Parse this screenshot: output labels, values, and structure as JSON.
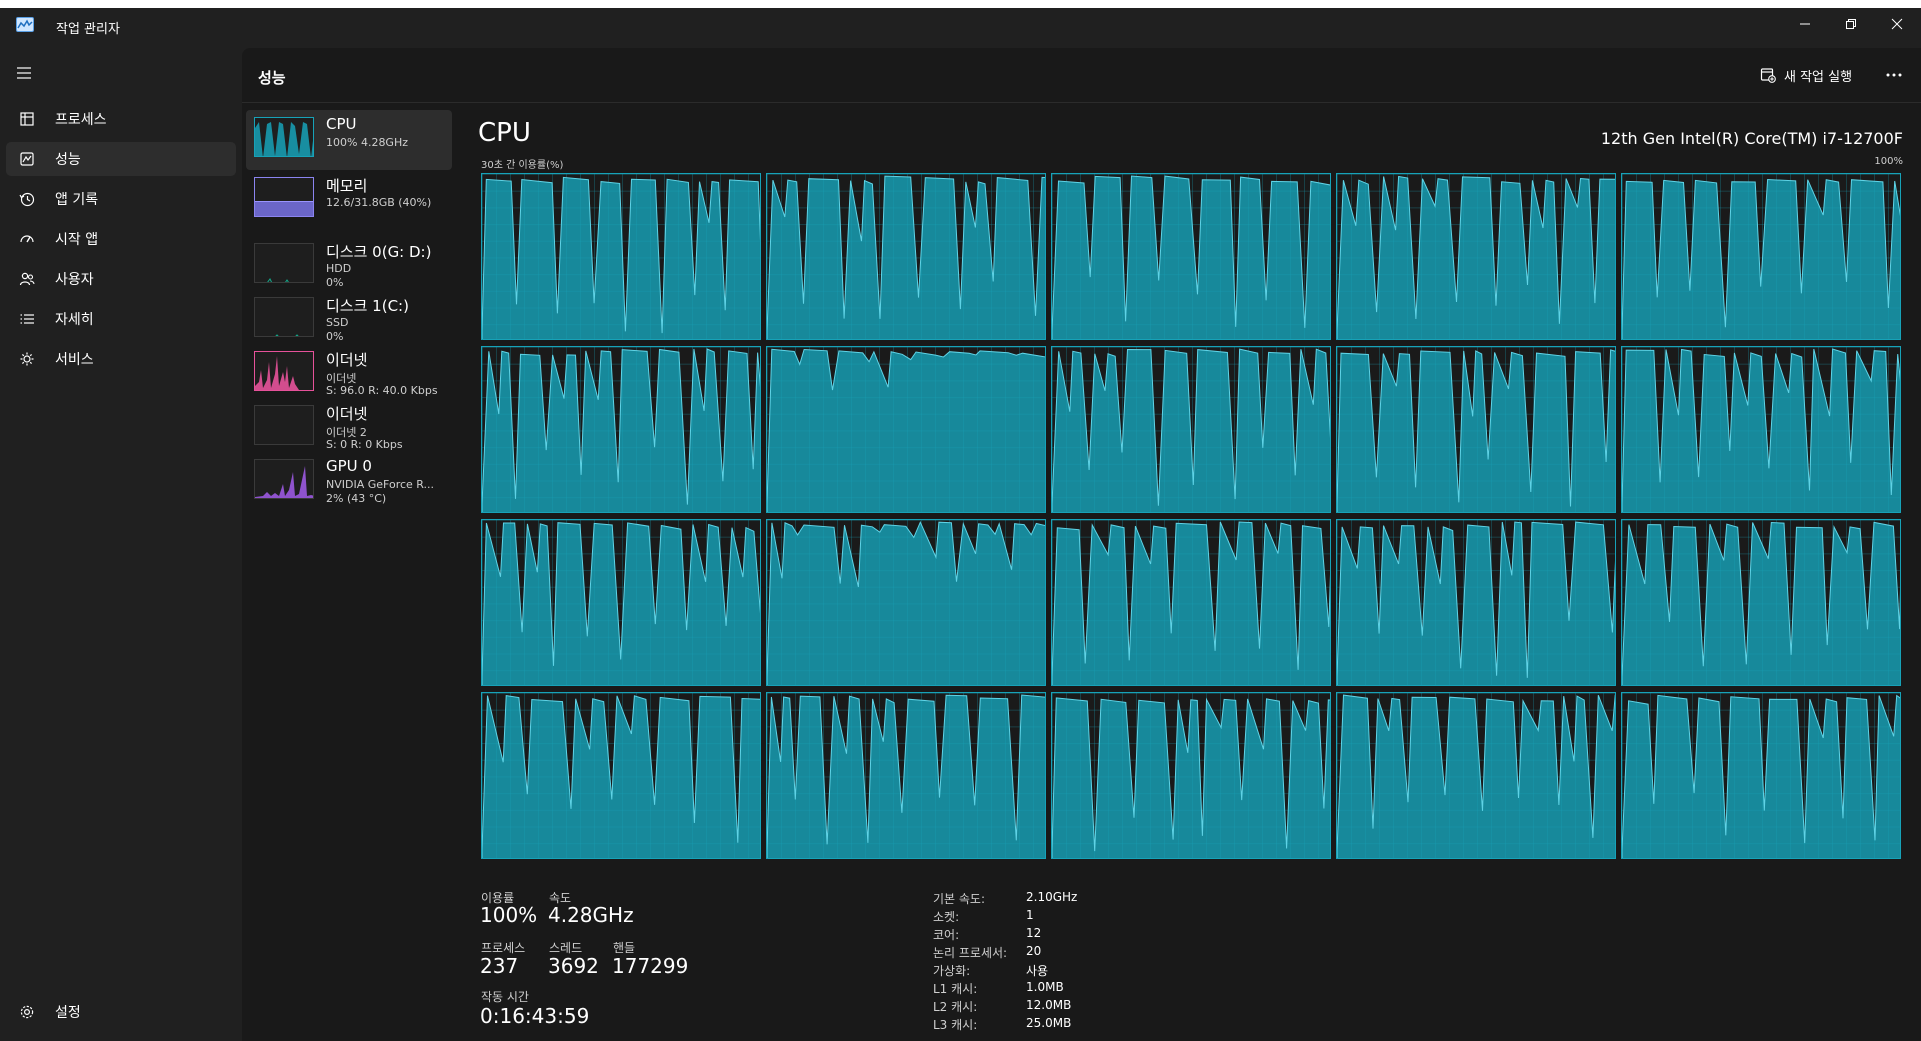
{
  "app": {
    "title": "작업 관리자"
  },
  "nav": {
    "items": [
      {
        "label": "프로세스",
        "icon": "processes-icon"
      },
      {
        "label": "성능",
        "icon": "performance-icon",
        "active": true
      },
      {
        "label": "앱 기록",
        "icon": "app-history-icon"
      },
      {
        "label": "시작 앱",
        "icon": "startup-apps-icon"
      },
      {
        "label": "사용자",
        "icon": "users-icon"
      },
      {
        "label": "자세히",
        "icon": "details-icon"
      },
      {
        "label": "서비스",
        "icon": "services-icon"
      }
    ],
    "settings_label": "설정"
  },
  "header": {
    "title": "성능",
    "new_task_label": "새 작업 실행"
  },
  "devices": [
    {
      "name": "CPU",
      "sub1": "100% 4.28GHz",
      "sub2": "",
      "color": "#17a2b8",
      "active": true
    },
    {
      "name": "메모리",
      "sub1": "12.6/31.8GB (40%)",
      "sub2": "",
      "color": "#8b84f0"
    },
    {
      "name": "디스크 0(G: D:)",
      "sub1": "HDD",
      "sub2": "0%",
      "color": "#13a88a"
    },
    {
      "name": "디스크 1(C:)",
      "sub1": "SSD",
      "sub2": "0%",
      "color": "#13a88a"
    },
    {
      "name": "이더넷",
      "sub1": "이더넷",
      "sub2": "S: 96.0  R: 40.0 Kbps",
      "color": "#e6529a"
    },
    {
      "name": "이더넷",
      "sub1": "이더넷 2",
      "sub2": "S: 0  R: 0 Kbps",
      "color": "#e6529a"
    },
    {
      "name": "GPU 0",
      "sub1": "NVIDIA GeForce R...",
      "sub2": "2% (43 °C)",
      "color": "#9b59e0"
    }
  ],
  "cpu": {
    "title": "CPU",
    "model": "12th Gen Intel(R) Core(TM) i7-12700F",
    "graph_label": "30초 간 이용률(%)",
    "graph_max": "100%",
    "logical_processors": 20,
    "accent": "#17a2b8",
    "stats": {
      "utilization_label": "이용률",
      "utilization_value": "100%",
      "speed_label": "속도",
      "speed_value": "4.28GHz",
      "processes_label": "프로세스",
      "processes_value": "237",
      "threads_label": "스레드",
      "threads_value": "3692",
      "handles_label": "핸들",
      "handles_value": "177299",
      "uptime_label": "작동 시간",
      "uptime_value": "0:16:43:59"
    },
    "specs": [
      {
        "label": "기본 속도:",
        "value": "2.10GHz"
      },
      {
        "label": "소켓:",
        "value": "1"
      },
      {
        "label": "코어:",
        "value": "12"
      },
      {
        "label": "논리 프로세서:",
        "value": "20"
      },
      {
        "label": "가상화:",
        "value": "사용"
      },
      {
        "label": "L1 캐시:",
        "value": "1.0MB"
      },
      {
        "label": "L2 캐시:",
        "value": "12.0MB"
      },
      {
        "label": "L3 캐시:",
        "value": "25.0MB"
      }
    ]
  }
}
